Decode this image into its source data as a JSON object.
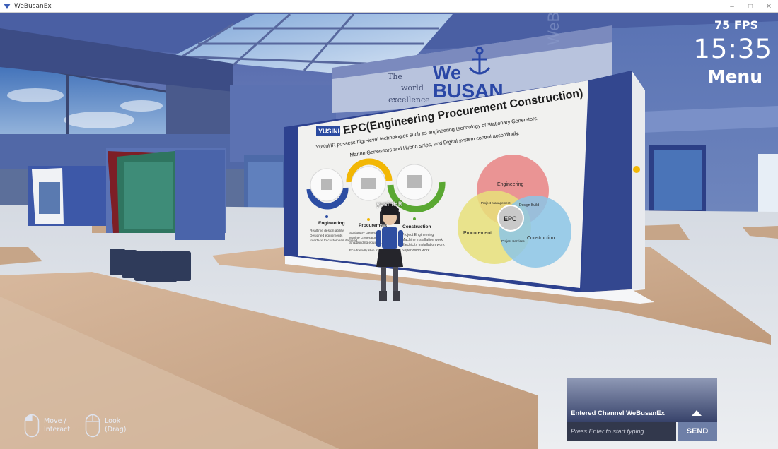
{
  "window": {
    "title": "WeBusanEx",
    "controls": [
      "minimize",
      "maximize",
      "close"
    ]
  },
  "hud": {
    "fps": "75 FPS",
    "time": "15:35",
    "menu_label": "Menu"
  },
  "player": {
    "name": "yusinHR"
  },
  "banner": {
    "tagline_line1": "The",
    "tagline_line2": "world",
    "tagline_line3": "excellence",
    "logo_top": "We",
    "logo_bottom": "BUSAN",
    "side_text": "WeBusanEx"
  },
  "booth_board": {
    "company_badge": "YUSINHR",
    "title": "EPC(Engineering Procurement Construction)",
    "description_line1": "YusinHR possess high-level technologies such as engineering technology of Stationary Generators,",
    "description_line2": "Marine Generators and Hybrid ships, and Digital system control accordingly.",
    "stages": [
      {
        "label": "Engineering",
        "items": [
          "Realtime design ability",
          "Designed equipments",
          "Interface to customer's demand"
        ]
      },
      {
        "label": "Procurement",
        "items": [
          "Stationary Generator",
          "Marine Generator",
          "Shipbuilding equipm... materials",
          "Eco-friendly ship materials"
        ]
      },
      {
        "label": "Construction",
        "items": [
          "Project Engineering",
          "Machine installation work",
          "Electricity installation work",
          "Supervision work"
        ]
      }
    ],
    "venn": {
      "center": "EPC",
      "circles": [
        "Engineering",
        "Procurement",
        "Construction"
      ],
      "overlaps": [
        "Project Management",
        "Design Build",
        "Project Services"
      ]
    }
  },
  "chat": {
    "last_message": "Entered Channel WeBusanEx",
    "input_placeholder": "Press Enter to start typing...",
    "send_label": "SEND"
  },
  "controls_hint": [
    {
      "line1": "Move /",
      "line2": "Interact"
    },
    {
      "line1": "Look",
      "line2": "(Drag)"
    }
  ],
  "colors": {
    "wall_blue": "#33478f",
    "floor_white": "#e9ebee",
    "wood": "#c9a688",
    "venn_engineering": "#e98a8a",
    "venn_procurement": "#e7e07a",
    "venn_construction": "#8cc6e6",
    "accent_yellow": "#f2b705",
    "accent_green": "#5aa832",
    "accent_blue": "#2d4ea3"
  }
}
